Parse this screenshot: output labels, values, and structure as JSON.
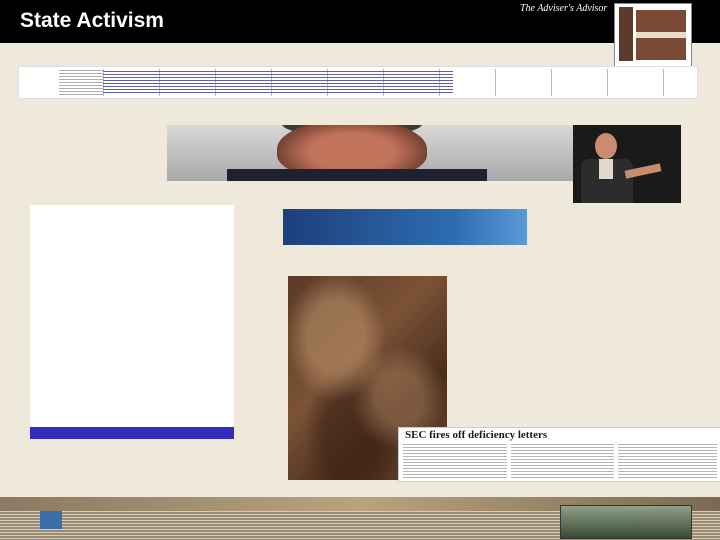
{
  "slide": {
    "title": "State Activism",
    "tagline": "The Adviser's Advisor"
  },
  "news_clipping": {
    "headline": "SEC fires off deficiency letters"
  },
  "colors": {
    "header_bg": "#000000",
    "slide_bg": "#efe9dc",
    "nag_bar": "#2e2eb8",
    "nasaa_banner": "#1d3f7a"
  },
  "images": [
    {
      "name": "market-counsel-logo"
    },
    {
      "name": "spreadsheet-strip"
    },
    {
      "name": "man-portrait-banner"
    },
    {
      "name": "speaker-at-podium-photo"
    },
    {
      "name": "attorneys-general-logo"
    },
    {
      "name": "nasaa-banner"
    },
    {
      "name": "marble-texture"
    },
    {
      "name": "newspaper-clipping"
    },
    {
      "name": "newsletter-footer-strip"
    }
  ]
}
